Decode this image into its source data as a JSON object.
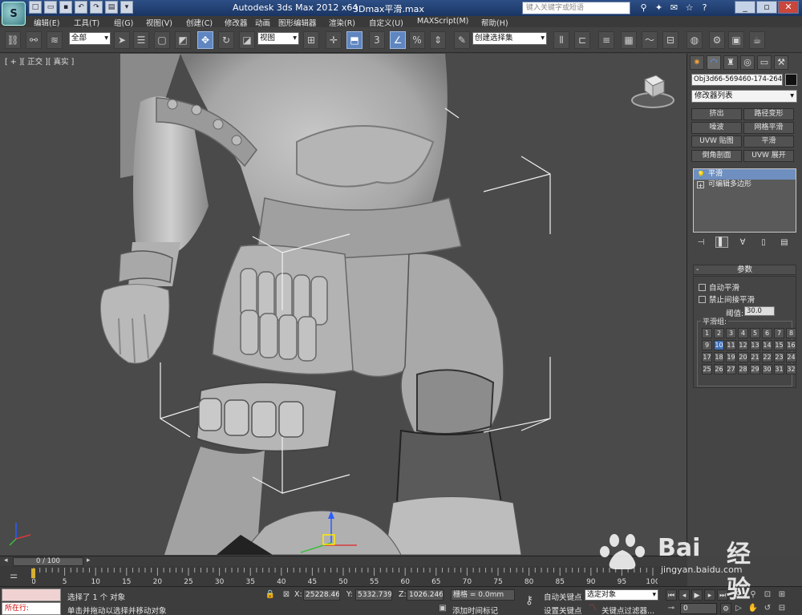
{
  "titlebar": {
    "app_title": "Autodesk 3ds Max  2012 x64",
    "file_name": "3Dmax平滑.max",
    "search_placeholder": "键入关键字或短语",
    "logo_text": "S"
  },
  "menu": {
    "items": [
      "编辑(E)",
      "工具(T)",
      "组(G)",
      "视图(V)",
      "创建(C)",
      "修改器",
      "动画",
      "图形编辑器",
      "渲染(R)",
      "自定义(U)",
      "MAXScript(M)",
      "帮助(H)"
    ]
  },
  "toolbar": {
    "selection_filter": "全部",
    "ref_coord": "视图",
    "named_selection": "创建选择集",
    "snap_label": "3"
  },
  "viewport": {
    "label": "[ + ][ 正交 ][ 真实 ]"
  },
  "command_panel": {
    "object_name": "Obj3d66-569460-174-264",
    "modifier_list": "修改器列表",
    "modifier_buttons": [
      "挤出",
      "路径变形",
      "噪波",
      "网格平滑",
      "UVW 贴图",
      "平滑",
      "倒角剖面",
      "UVW 展开"
    ],
    "stack": [
      {
        "label": "平滑",
        "selected": true
      },
      {
        "label": "可编辑多边形",
        "selected": false
      }
    ],
    "params_title": "参数",
    "auto_smooth": "自动平滑",
    "prevent_indirect": "禁止间接平滑",
    "threshold_label": "阈值:",
    "threshold_value": "30.0",
    "smoothing_groups_title": "平滑组:",
    "smoothing_groups": [
      "1",
      "2",
      "3",
      "4",
      "5",
      "6",
      "7",
      "8",
      "9",
      "10",
      "11",
      "12",
      "13",
      "14",
      "15",
      "16",
      "17",
      "18",
      "19",
      "20",
      "21",
      "22",
      "23",
      "24",
      "25",
      "26",
      "27",
      "28",
      "29",
      "30",
      "31",
      "32"
    ],
    "active_group": "10"
  },
  "timeline": {
    "slider_label": "0 / 100",
    "tick_labels": [
      "0",
      "5",
      "10",
      "15",
      "20",
      "25",
      "30",
      "35",
      "40",
      "45",
      "50",
      "55",
      "60",
      "65",
      "70",
      "75",
      "80",
      "85",
      "90",
      "95",
      "100"
    ]
  },
  "status": {
    "listener_text": "所在行:",
    "selected_text": "选择了 1 个 对象",
    "hint_text": "单击并拖动以选择并移动对象",
    "x_label": "X:",
    "x_value": "25228.463",
    "y_label": "Y:",
    "y_value": "5332.739m",
    "z_label": "Z:",
    "z_value": "1026.246m",
    "grid_text": "栅格 = 0.0mm",
    "add_time_tag": "添加时间标记",
    "auto_key": "自动关键点",
    "set_key": "设置关键点",
    "selected_obj": "选定对象",
    "key_filters": "关键点过滤器...",
    "frame_value": "0"
  },
  "watermark": {
    "brand": "Bai",
    "brand2": "经验",
    "url": "jingyan.baidu.com"
  }
}
